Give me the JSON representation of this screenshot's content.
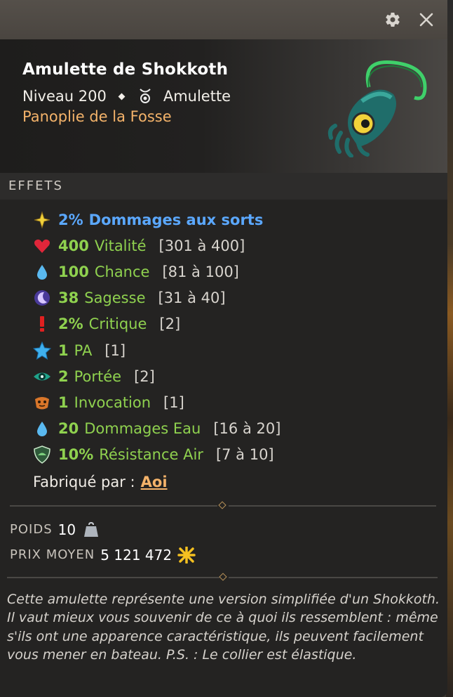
{
  "window": {
    "settings_icon": "gear-icon",
    "close_icon": "close-icon"
  },
  "item": {
    "name": "Amulette de Shokkoth",
    "level": "Niveau 200",
    "type": "Amulette",
    "set": "Panoplie de la Fosse"
  },
  "effects_section": {
    "title": "EFFETS",
    "effects": [
      {
        "icon": "star-icon",
        "value": "2%",
        "label": "Dommages aux sorts",
        "range": ""
      },
      {
        "icon": "heart-icon",
        "value": "400",
        "label": "Vitalité",
        "range": "[301 à 400]"
      },
      {
        "icon": "water-drop-icon",
        "value": "100",
        "label": "Chance",
        "range": "[81 à 100]"
      },
      {
        "icon": "moon-icon",
        "value": "38",
        "label": "Sagesse",
        "range": "[31 à 40]"
      },
      {
        "icon": "exclamation-icon",
        "value": "2%",
        "label": "Critique",
        "range": "[2]"
      },
      {
        "icon": "blue-star-icon",
        "value": "1",
        "label": "PA",
        "range": "[1]"
      },
      {
        "icon": "eye-icon",
        "value": "2",
        "label": "Portée",
        "range": "[2]"
      },
      {
        "icon": "summon-icon",
        "value": "1",
        "label": "Invocation",
        "range": "[1]"
      },
      {
        "icon": "water-drop-icon",
        "value": "20",
        "label": "Dommages Eau",
        "range": "[16 à 20]"
      },
      {
        "icon": "shield-air-icon",
        "value": "10%",
        "label": "Résistance Air",
        "range": "[7 à 10]"
      }
    ],
    "crafted_label": "Fabriqué par :",
    "crafted_by": "Aoi"
  },
  "stats": {
    "weight_label": "POIDS",
    "weight_value": "10",
    "price_label": "PRIX MOYEN",
    "price_value": "5 121 472"
  },
  "description": "Cette amulette représente une version simplifiée d'un Shokkoth. Il vaut mieux vous souvenir de ce à quoi ils ressemblent : même s'ils ont une apparence caractéristique, ils peuvent facilement vous mener en bateau. P.S. : Le collier est élastique.",
  "colors": {
    "set": "#f4b36a",
    "effect_green": "#8fd14f",
    "effect_blue": "#5ba8ff"
  }
}
